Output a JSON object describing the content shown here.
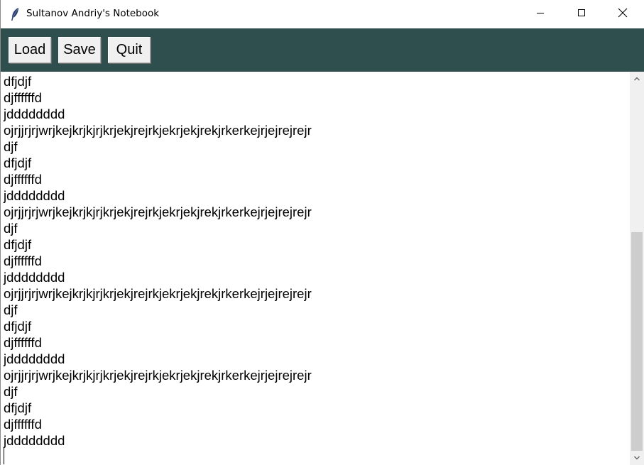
{
  "window": {
    "title": "Sultanov Andriy's Notebook",
    "controls": [
      "minimize",
      "maximize",
      "close"
    ]
  },
  "toolbar": {
    "background": "#2f4f4f",
    "load_label": "Load",
    "save_label": "Save",
    "quit_label": "Quit"
  },
  "editor": {
    "lines": [
      "dfjdjf",
      "djffffffd",
      "jdddddddd",
      "ojrjjrjrjwrjkejkrjkjrjkrjekjrejrkjekrjekjrekjrkerkejrjejrejrejr",
      "djf",
      "dfjdjf",
      "djffffffd",
      "jdddddddd",
      "ojrjjrjrjwrjkejkrjkjrjkrjekjrejrkjekrjekjrekjrkerkejrjejrejrejr",
      "djf",
      "dfjdjf",
      "djffffffd",
      "jdddddddd",
      "ojrjjrjrjwrjkejkrjkjrjkrjekjrejrkjekrjekjrekjrkerkejrjejrejrejr",
      "djf",
      "dfjdjf",
      "djffffffd",
      "jdddddddd",
      "ojrjjrjrjwrjkejkrjkjrjkrjekjrejrkjekrjekjrekjrkerkejrjejrejrejr",
      "djf",
      "dfjdjf",
      "djffffffd",
      "jdddddddd"
    ]
  },
  "scrollbar": {
    "scroll_position": 0.48
  }
}
